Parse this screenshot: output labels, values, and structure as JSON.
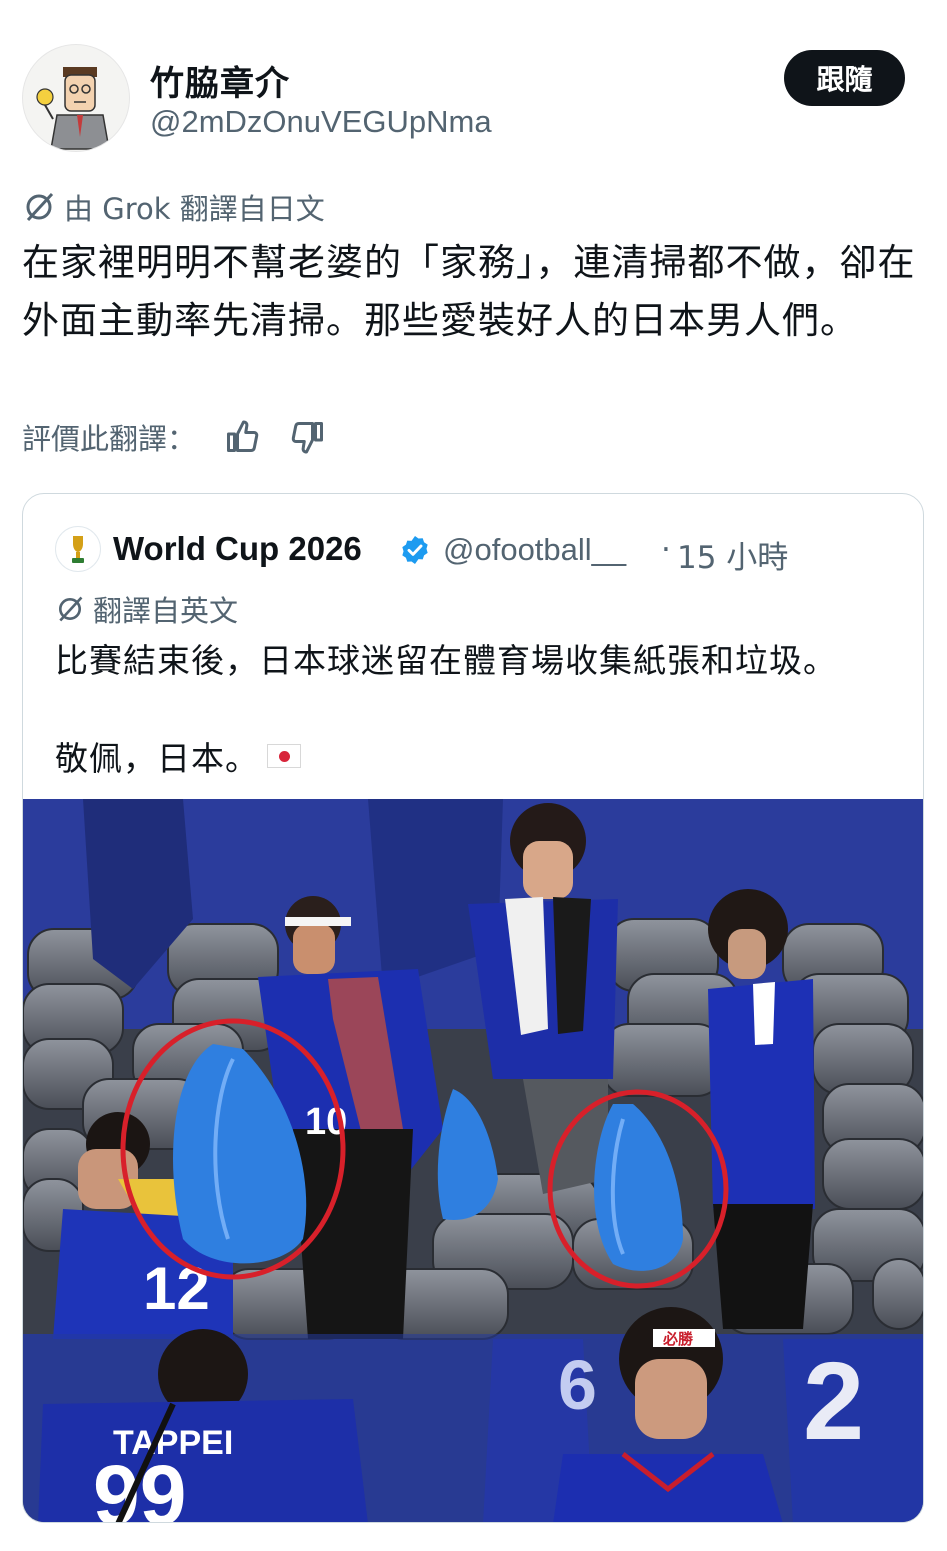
{
  "author": {
    "display_name": "竹脇章介",
    "handle": "@2mDzOnuVEGUpNma"
  },
  "follow_label": "跟隨",
  "translation_note": "由 Grok 翻譯自日文",
  "tweet_text": "在家裡明明不幫老婆的「家務」，連清掃都不做，卻在外面主動率先清掃。那些愛裝好人的日本男人們。",
  "rate_label": "評價此翻譯：",
  "quote": {
    "name": "World Cup 2026",
    "handle": "@ofootball__",
    "dot": "·",
    "time": "15 小時",
    "translate_label": "翻譯自英文",
    "text_line1": "比賽結束後，日本球迷留在體育場收集紙張和垃圾。",
    "text_line2": "敬佩，日本。"
  },
  "photo": {
    "jersey_numbers": [
      "10",
      "12",
      "TAPPEI",
      "99",
      "6",
      "2"
    ],
    "headband_text": "必勝",
    "circle_color": "#d8202a",
    "bag_color": "#2f7fe0"
  },
  "colors": {
    "accent": "#1d9bf0",
    "muted": "#536471",
    "follow_bg": "#0f1419"
  }
}
